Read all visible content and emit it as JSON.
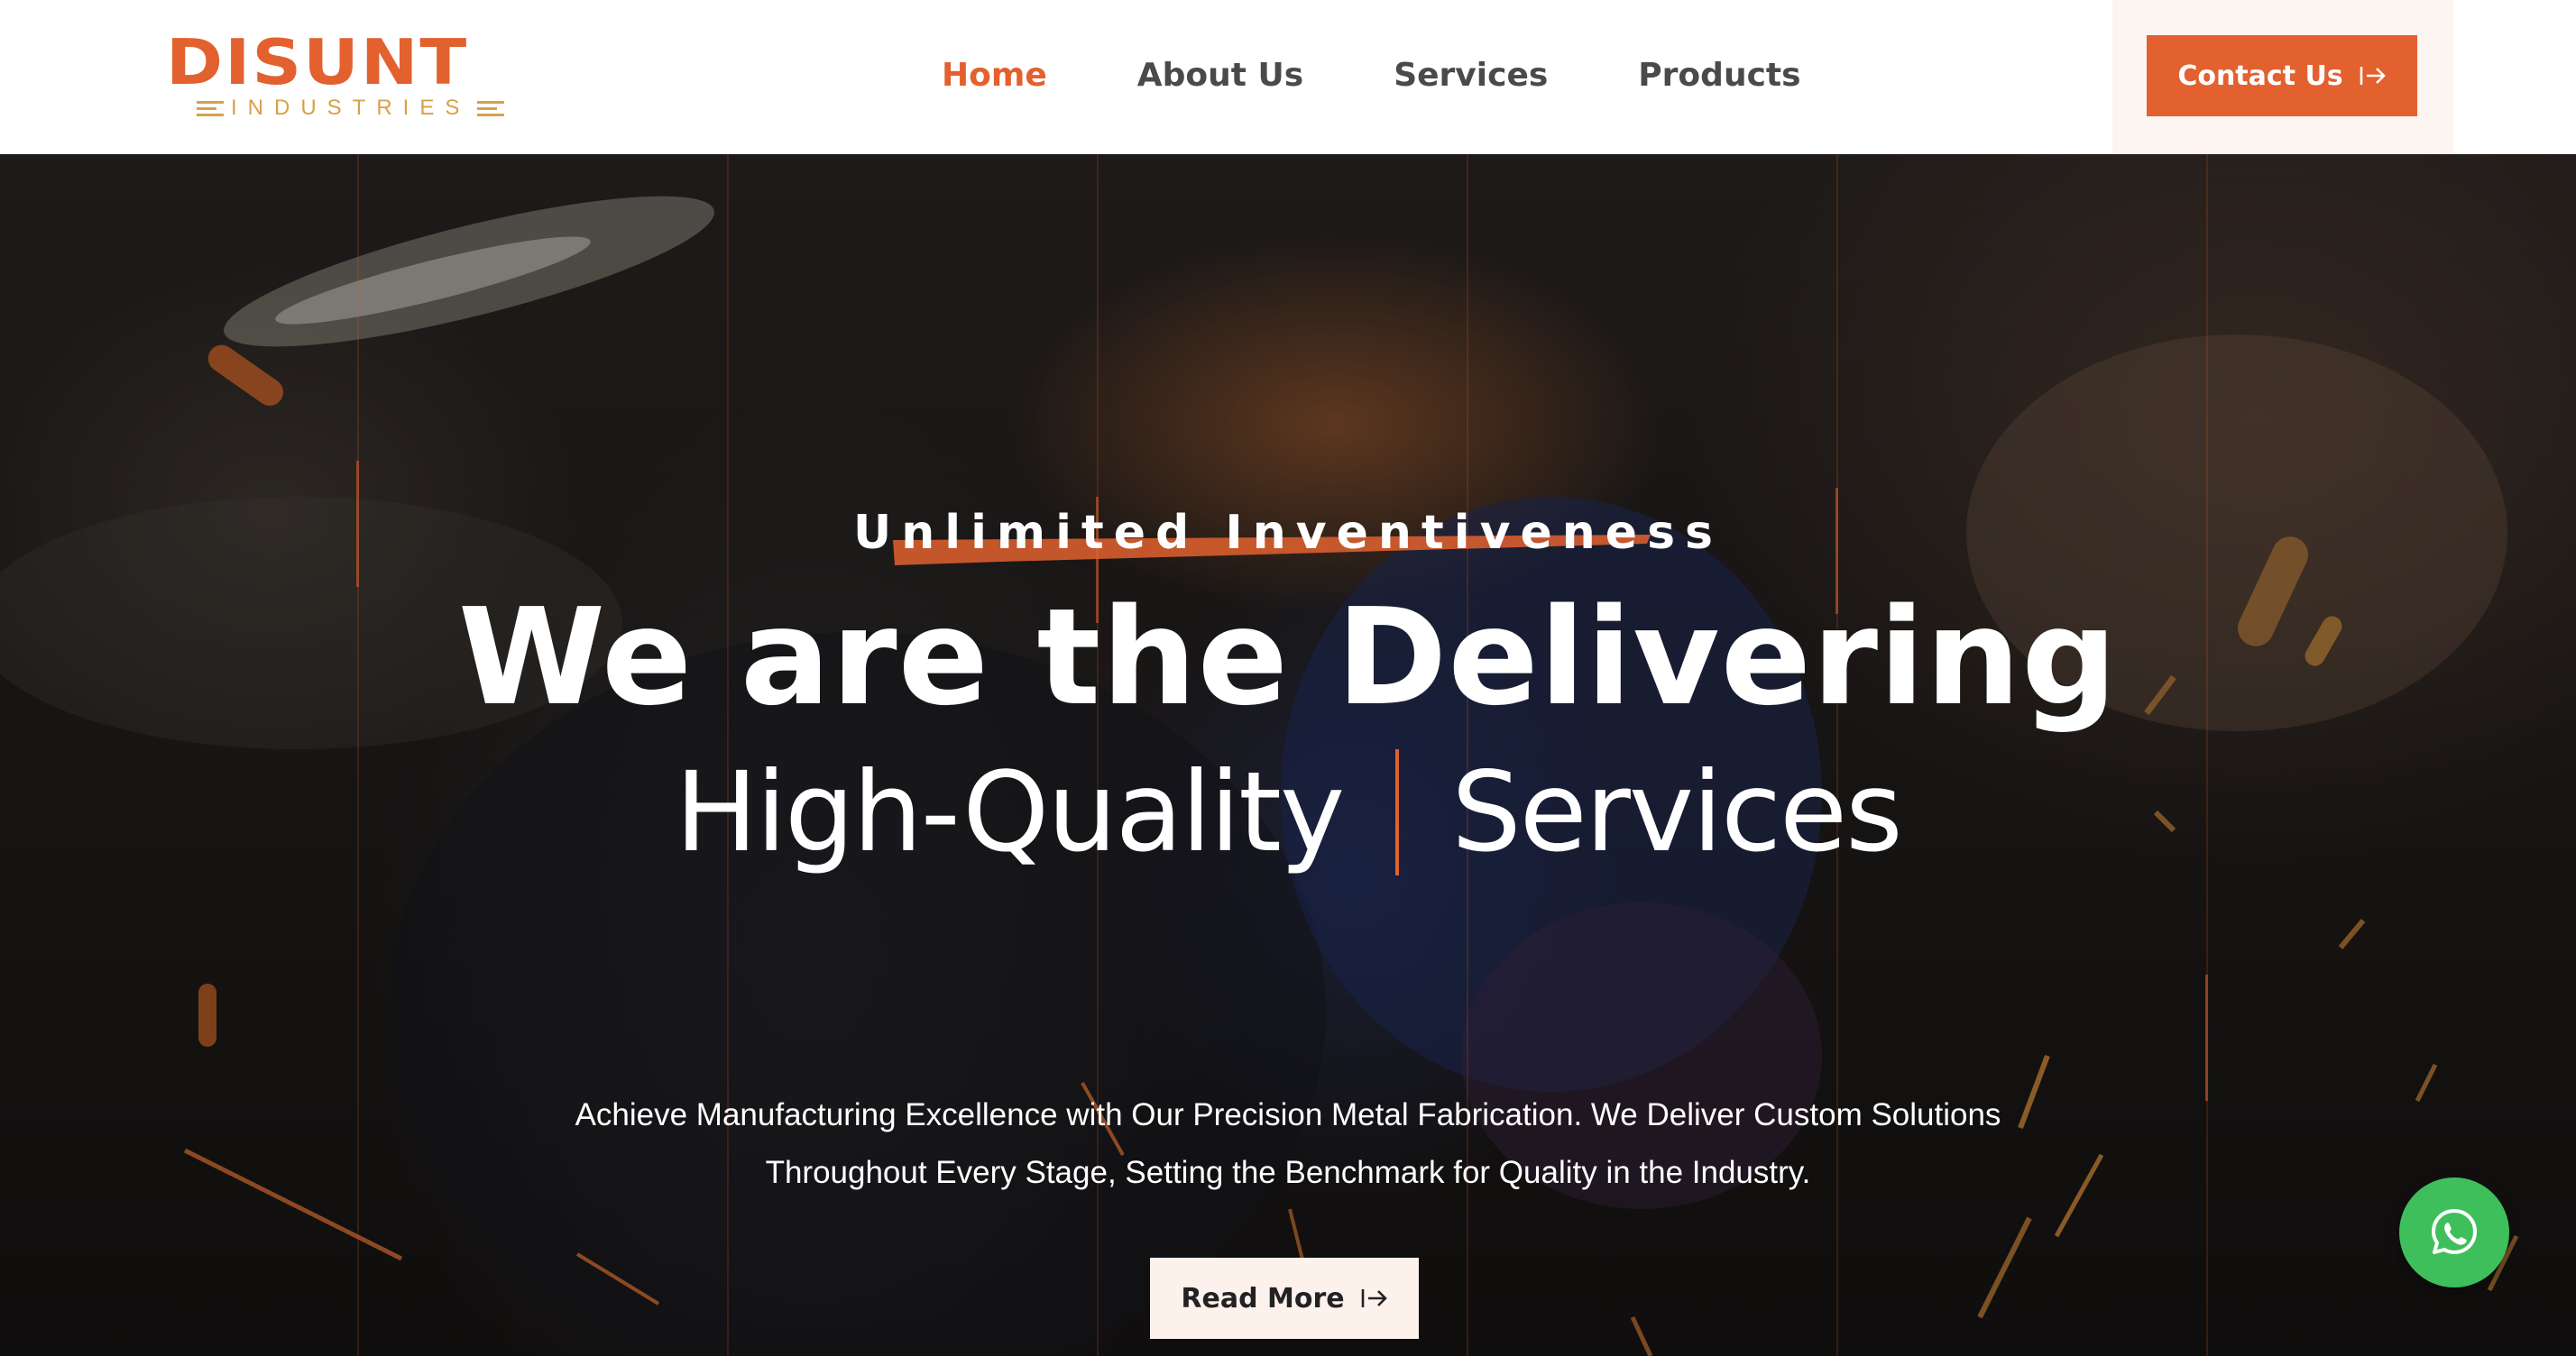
{
  "brand": {
    "logo_word": "DISUNT",
    "logo_sub": "INDUSTRIES",
    "accent_color": "#e2612f",
    "gold_color": "#d9a04a"
  },
  "nav": {
    "items": [
      {
        "label": "Home",
        "active": true
      },
      {
        "label": "About Us",
        "active": false
      },
      {
        "label": "Services",
        "active": false
      },
      {
        "label": "Products",
        "active": false
      }
    ],
    "contact_label": "Contact Us",
    "contact_icon": "arrow-right-from-bar-icon"
  },
  "hero": {
    "eyebrow": "Unlimited Inventiveness",
    "headline": "We are the Delivering",
    "subline_left": "High-Quality",
    "subline_right": "Services",
    "description_line1": "Achieve Manufacturing Excellence with Our Precision Metal Fabrication. We Deliver Custom Solutions",
    "description_line2": "Throughout Every Stage, Setting the Benchmark for Quality in the Industry.",
    "cta_label": "Read More",
    "cta_icon": "arrow-right-from-bar-icon",
    "background_image": "welder-with-sparks-photo"
  },
  "floating": {
    "whatsapp_icon": "whatsapp-icon",
    "whatsapp_color": "#3fbf5b"
  }
}
